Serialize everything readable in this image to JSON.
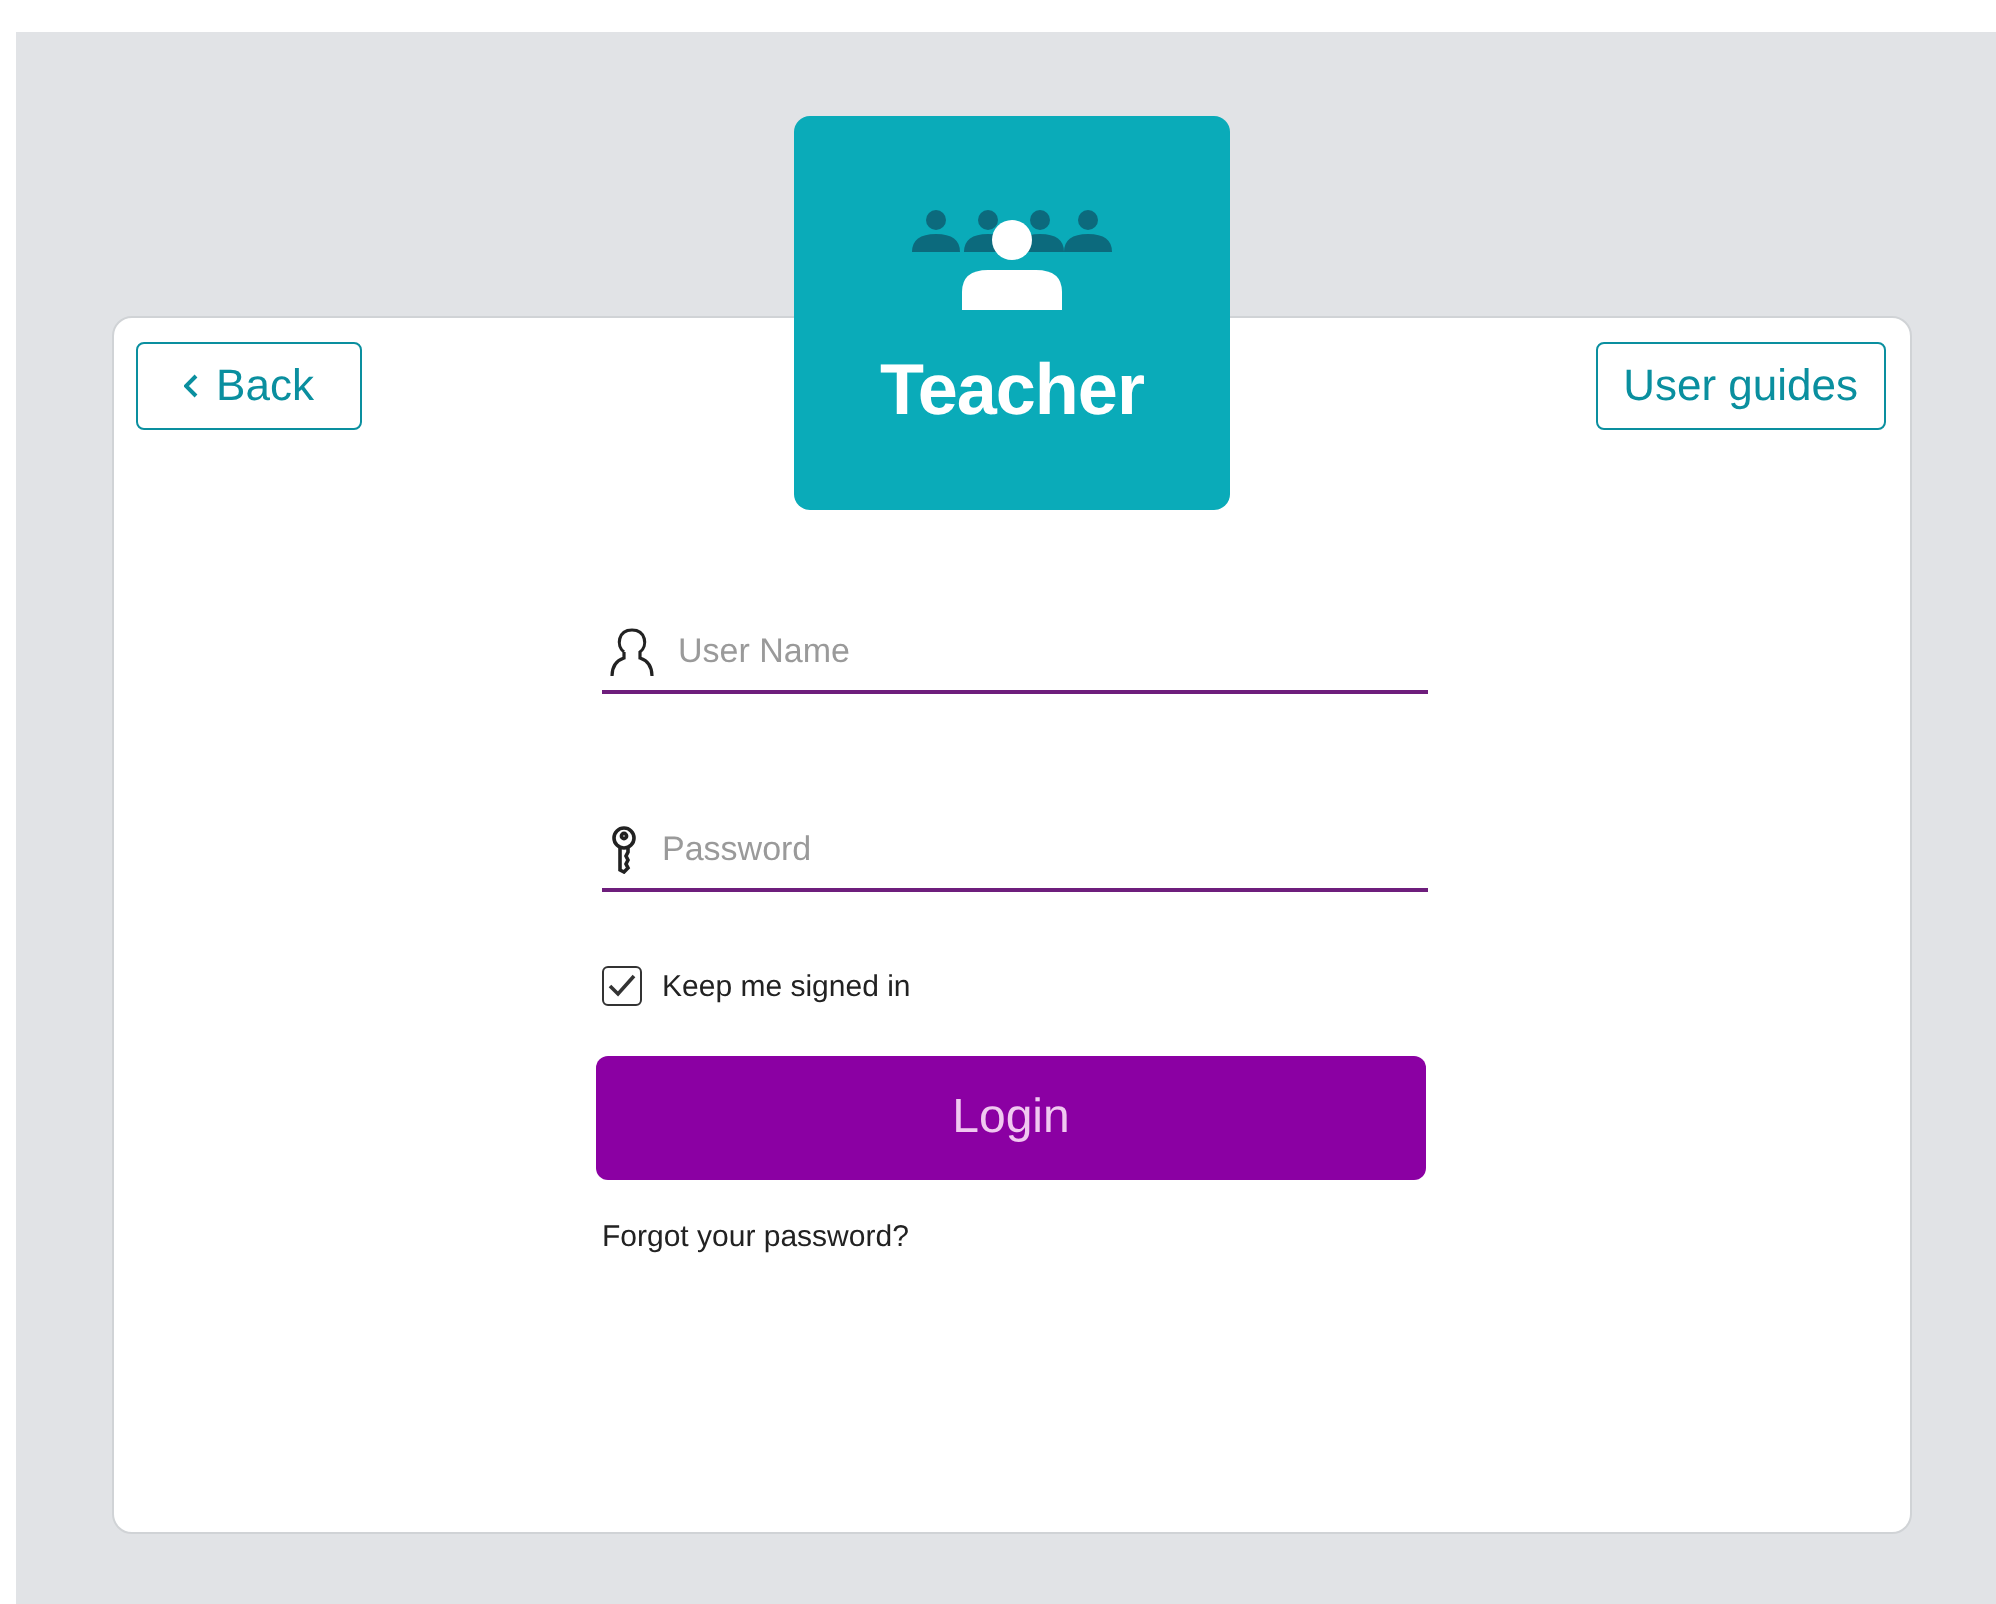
{
  "role_badge": {
    "label": "Teacher"
  },
  "back_button": {
    "label": "Back"
  },
  "user_guides_button": {
    "label": "User guides"
  },
  "fields": [
    {
      "kind": "user",
      "placeholder": "User Name"
    },
    {
      "kind": "password",
      "placeholder": "Password"
    }
  ],
  "keep_signed_in": {
    "label": "Keep me signed in",
    "checked": true
  },
  "login_button": {
    "label": "Login"
  },
  "forgot_link": {
    "label": "Forgot your password?"
  }
}
